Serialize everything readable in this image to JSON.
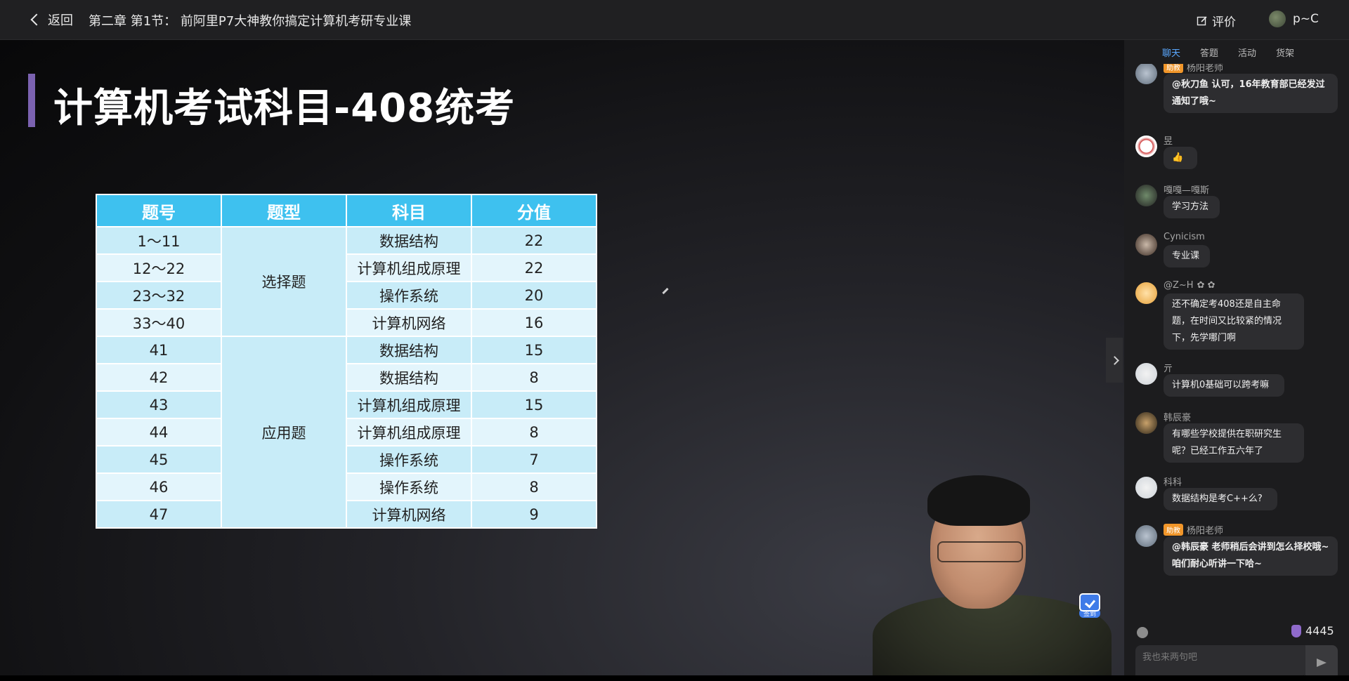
{
  "topbar": {
    "back_label": "返回",
    "course_title": "第二章 第1节：  前阿里P7大神教你搞定计算机考研专业课",
    "rate_label": "评价",
    "user_name": "p~C"
  },
  "slide": {
    "title": "计算机考试科目-408统考",
    "table": {
      "headers": [
        "题号",
        "题型",
        "科目",
        "分值"
      ],
      "rows": [
        [
          "1～11",
          "选择题",
          "数据结构",
          "22"
        ],
        [
          "12～22",
          "",
          "计算机组成原理",
          "22"
        ],
        [
          "23～32",
          "",
          "操作系统",
          "20"
        ],
        [
          "33～40",
          "",
          "计算机网络",
          "16"
        ],
        [
          "41",
          "应用题",
          "数据结构",
          "15"
        ],
        [
          "42",
          "",
          "数据结构",
          "8"
        ],
        [
          "43",
          "",
          "计算机组成原理",
          "15"
        ],
        [
          "44",
          "",
          "计算机组成原理",
          "8"
        ],
        [
          "45",
          "",
          "操作系统",
          "7"
        ],
        [
          "46",
          "",
          "操作系统",
          "8"
        ],
        [
          "47",
          "",
          "计算机网络",
          "9"
        ]
      ]
    }
  },
  "checkin_label": "签到",
  "chat": {
    "tabs": [
      "聊天",
      "答题",
      "活动",
      "货架"
    ],
    "active_tab": "聊天",
    "assistant_badge": "助教",
    "messages": [
      {
        "name": "杨阳老师",
        "text": "@秋刀鱼 认可，16年教育部已经发过通知了哦~"
      },
      {
        "name": "昱",
        "text": "👍"
      },
      {
        "name": "嘎嘎—嘎斯",
        "text": "学习方法"
      },
      {
        "name": "Cynicism",
        "text": "专业课"
      },
      {
        "name": "@Z~H",
        "text": "还不确定考408还是自主命题，在时间又比较紧的情况下，先学哪门啊"
      },
      {
        "name": "亓",
        "text": "计算机0基础可以跨考嘛"
      },
      {
        "name": "韩辰豪",
        "text": "有哪些学校提供在职研究生呢？已经工作五六年了"
      },
      {
        "name": "科科",
        "text": "数据结构是考C++么?"
      },
      {
        "name": "杨阳老师",
        "text": "@韩辰豪 老师稍后会讲到怎么择校哦~咱们耐心听讲一下哈~"
      }
    ],
    "like_count": "4445",
    "input_placeholder": "我也来两句吧"
  },
  "colors": {
    "table_header": "#3ec1ef",
    "accent_bar": "#7b62b0",
    "active_tab": "#5aa8ff",
    "badge": "#f1962a"
  }
}
